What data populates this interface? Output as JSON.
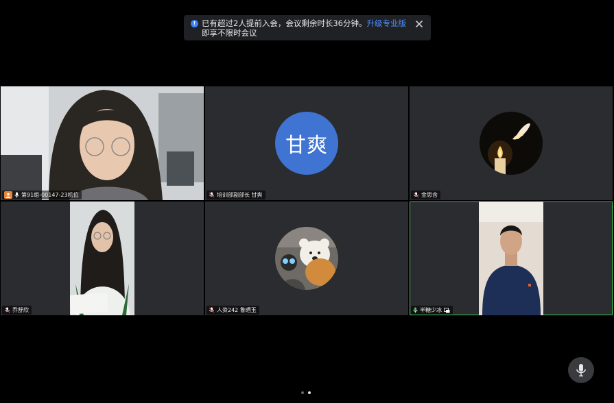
{
  "banner": {
    "text_before": "已有超过2人提前入会，会议剩余时长36分钟。",
    "upgrade_link": "升级专业版",
    "text_after": "即享不限时会议"
  },
  "participants": [
    {
      "name": "第91组-00147-23机位",
      "host": true,
      "muted": false
    },
    {
      "name": "培训部副部长 甘爽",
      "avatar_text": "甘爽",
      "muted": true
    },
    {
      "name": "金思含",
      "muted": true
    },
    {
      "name": "乔舒欣",
      "muted": true
    },
    {
      "name": "人资242 鲁晒玉",
      "muted": true
    },
    {
      "name": "半糖少冰",
      "speaking": true,
      "muted": false,
      "screen_share": true
    }
  ],
  "pagination": {
    "current": 2,
    "total": 2
  },
  "colors": {
    "active_speaker": "#3ecf5a",
    "avatar_bg": "#3f74d2",
    "link": "#4a90ff",
    "host_badge": "#e8843a"
  }
}
